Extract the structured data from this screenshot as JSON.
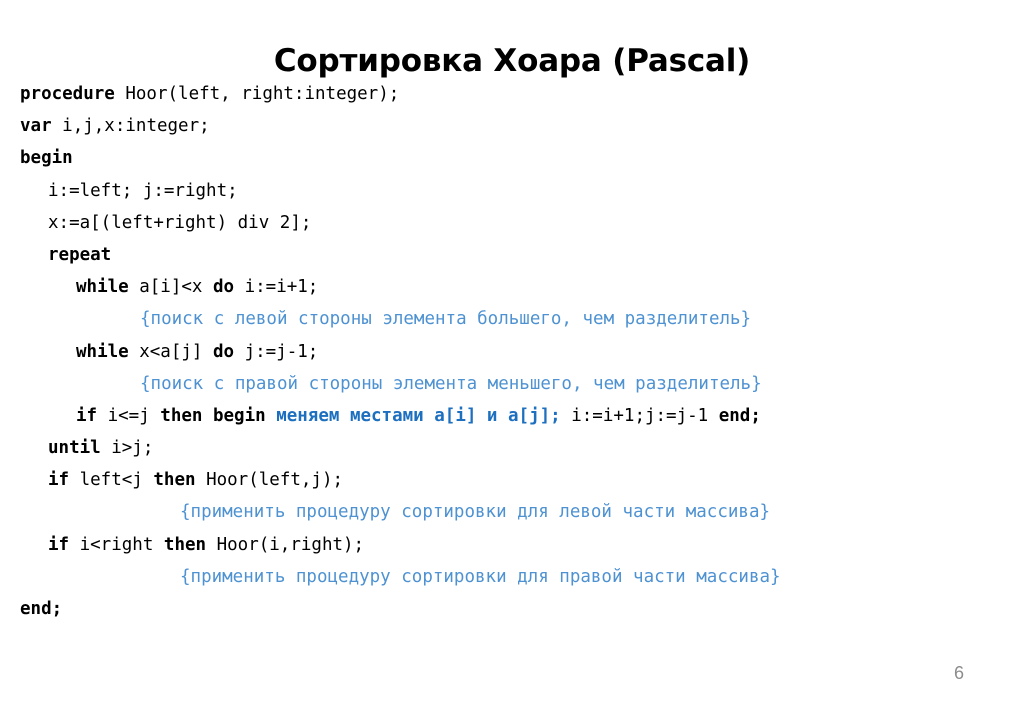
{
  "slide": {
    "title": "Сортировка Хоара (Pascal)",
    "page_number": "6",
    "language": "Pascal",
    "colors": {
      "title": "#000000",
      "code": "#000000",
      "comment_blue": "#4E92D2",
      "highlight_blue": "#1D6FBF",
      "page_number": "#8C8C8C",
      "background": "#FFFFFF"
    }
  },
  "code": {
    "lines": [
      {
        "id": "line-procedure",
        "indent": 0,
        "kind": "code",
        "segments": [
          {
            "text": "procedure ",
            "style": "kw"
          },
          {
            "text": "Hoor(left, right:integer);",
            "style": "plain"
          }
        ]
      },
      {
        "id": "line-var",
        "indent": 0,
        "kind": "code",
        "segments": [
          {
            "text": "var ",
            "style": "kw"
          },
          {
            "text": "i,j,x:integer;",
            "style": "plain"
          }
        ]
      },
      {
        "id": "line-begin",
        "indent": 0,
        "kind": "code",
        "segments": [
          {
            "text": "begin",
            "style": "kw"
          }
        ]
      },
      {
        "id": "line-init-ij",
        "indent": 1,
        "kind": "code",
        "segments": [
          {
            "text": "i:=left; j:=right;",
            "style": "plain"
          }
        ]
      },
      {
        "id": "line-pivot",
        "indent": 1,
        "kind": "code",
        "segments": [
          {
            "text": "x:=a[(left+right) div 2];",
            "style": "plain"
          }
        ]
      },
      {
        "id": "line-repeat",
        "indent": 1,
        "kind": "code",
        "segments": [
          {
            "text": "repeat",
            "style": "kw"
          }
        ]
      },
      {
        "id": "line-while-left",
        "indent": 2,
        "kind": "code",
        "segments": [
          {
            "text": "while ",
            "style": "kw"
          },
          {
            "text": "a[i]<x ",
            "style": "plain"
          },
          {
            "text": "do ",
            "style": "kw"
          },
          {
            "text": "i:=i+1;",
            "style": "plain"
          }
        ]
      },
      {
        "id": "comment-left-search",
        "indent": "c1",
        "kind": "comment",
        "segments": [
          {
            "text": "{поиск с левой стороны элемента большего, чем разделитель}",
            "style": "comment"
          }
        ]
      },
      {
        "id": "line-while-right",
        "indent": 2,
        "kind": "code",
        "segments": [
          {
            "text": "while ",
            "style": "kw"
          },
          {
            "text": "x<a[j] ",
            "style": "plain"
          },
          {
            "text": "do ",
            "style": "kw"
          },
          {
            "text": "j:=j-1;",
            "style": "plain"
          }
        ]
      },
      {
        "id": "comment-right-search",
        "indent": "c1",
        "kind": "comment",
        "segments": [
          {
            "text": "{поиск с правой стороны элемента меньшего, чем разделитель}",
            "style": "comment"
          }
        ]
      },
      {
        "id": "line-swap",
        "indent": 2,
        "kind": "code",
        "segments": [
          {
            "text": "if ",
            "style": "kw"
          },
          {
            "text": "i<=j ",
            "style": "plain"
          },
          {
            "text": "then begin ",
            "style": "kw"
          },
          {
            "text": "меняем местами a[i] и a[j];",
            "style": "hl"
          },
          {
            "text": " i:=i+1;j:=j-1 ",
            "style": "plain"
          },
          {
            "text": "end;",
            "style": "kw"
          }
        ]
      },
      {
        "id": "line-until",
        "indent": 1,
        "kind": "code",
        "segments": [
          {
            "text": "until ",
            "style": "kw"
          },
          {
            "text": "i>j;",
            "style": "plain"
          }
        ]
      },
      {
        "id": "line-recurse-left",
        "indent": 1,
        "kind": "code",
        "segments": [
          {
            "text": "if ",
            "style": "kw"
          },
          {
            "text": "left<j ",
            "style": "plain"
          },
          {
            "text": "then ",
            "style": "kw"
          },
          {
            "text": "Hoor(left,j);",
            "style": "plain"
          }
        ]
      },
      {
        "id": "comment-left-part",
        "indent": "c2",
        "kind": "comment",
        "segments": [
          {
            "text": "{применить процедуру сортировки для левой части массива}",
            "style": "comment"
          }
        ]
      },
      {
        "id": "line-recurse-right",
        "indent": 1,
        "kind": "code",
        "segments": [
          {
            "text": "if ",
            "style": "kw"
          },
          {
            "text": "i<right ",
            "style": "plain"
          },
          {
            "text": "then ",
            "style": "kw"
          },
          {
            "text": "Hoor(i,right);",
            "style": "plain"
          }
        ]
      },
      {
        "id": "comment-right-part",
        "indent": "c2",
        "kind": "comment",
        "segments": [
          {
            "text": "{применить процедуру сортировки для правой части массива}",
            "style": "comment"
          }
        ]
      },
      {
        "id": "line-end",
        "indent": 0,
        "kind": "code",
        "segments": [
          {
            "text": "end;",
            "style": "kw"
          }
        ]
      }
    ]
  }
}
